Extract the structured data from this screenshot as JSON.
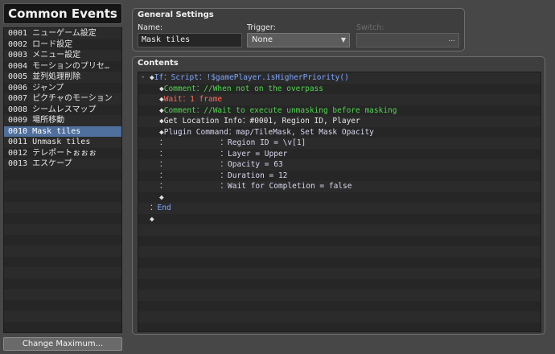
{
  "left_panel": {
    "title": "Common Events",
    "events": [
      {
        "id": "0001",
        "name": "ニューゲーム設定"
      },
      {
        "id": "0002",
        "name": "ロード設定"
      },
      {
        "id": "0003",
        "name": "メニュー設定"
      },
      {
        "id": "0004",
        "name": "モーションのプリセ…"
      },
      {
        "id": "0005",
        "name": "並列処理削除"
      },
      {
        "id": "0006",
        "name": "ジャンプ"
      },
      {
        "id": "0007",
        "name": "ピクチャのモーション"
      },
      {
        "id": "0008",
        "name": "シームレスマップ"
      },
      {
        "id": "0009",
        "name": "場所移動"
      },
      {
        "id": "0010",
        "name": "Mask tiles"
      },
      {
        "id": "0011",
        "name": "Unmask tiles"
      },
      {
        "id": "0012",
        "name": "テレポートぉぉぉ"
      },
      {
        "id": "0013",
        "name": "エスケープ"
      }
    ],
    "selected_index": 9,
    "change_max_label": "Change Maximum..."
  },
  "general_settings": {
    "title": "General Settings",
    "name_label": "Name:",
    "name_value": "Mask tiles",
    "trigger_label": "Trigger:",
    "trigger_value": "None",
    "switch_label": "Switch:",
    "switch_button": "..."
  },
  "contents": {
    "title": "Contents",
    "lines": [
      {
        "indent": 0,
        "toggle": "-",
        "diamond": true,
        "parts": [
          {
            "t": "If：Script：!$gamePlayer.isHigherPriority()",
            "c": "blue"
          }
        ]
      },
      {
        "indent": 1,
        "diamond": true,
        "parts": [
          {
            "t": "Comment：//When not on the overpass",
            "c": "green"
          }
        ]
      },
      {
        "indent": 1,
        "diamond": true,
        "parts": [
          {
            "t": "Wait：1 frame",
            "c": "red"
          }
        ]
      },
      {
        "indent": 1,
        "diamond": true,
        "parts": [
          {
            "t": "Comment：//Wait to execute unmasking before masking",
            "c": "green"
          }
        ]
      },
      {
        "indent": 1,
        "diamond": true,
        "parts": [
          {
            "t": "Get Location Info：",
            "c": "white"
          },
          {
            "t": "#0001, Region ID, Player",
            "c": "white"
          }
        ]
      },
      {
        "indent": 1,
        "diamond": true,
        "parts": [
          {
            "t": "Plugin Command：",
            "c": "light"
          },
          {
            "t": "map/TileMask, Set Mask Opacity",
            "c": "light"
          }
        ]
      },
      {
        "indent": 1,
        "colon": true,
        "parts": [
          {
            "t": "Region ID = \\v[1]",
            "c": "light"
          }
        ]
      },
      {
        "indent": 1,
        "colon": true,
        "parts": [
          {
            "t": "Layer = Upper",
            "c": "light"
          }
        ]
      },
      {
        "indent": 1,
        "colon": true,
        "parts": [
          {
            "t": "Opacity = 63",
            "c": "light"
          }
        ]
      },
      {
        "indent": 1,
        "colon": true,
        "parts": [
          {
            "t": "Duration = 12",
            "c": "light"
          }
        ]
      },
      {
        "indent": 1,
        "colon": true,
        "parts": [
          {
            "t": "Wait for Completion = false",
            "c": "light"
          }
        ]
      },
      {
        "indent": 1,
        "diamond": true,
        "parts": []
      },
      {
        "indent": 0,
        "end": true,
        "parts": [
          {
            "t": "End",
            "c": "blue"
          }
        ]
      },
      {
        "indent": 0,
        "diamond": true,
        "parts": []
      }
    ]
  }
}
